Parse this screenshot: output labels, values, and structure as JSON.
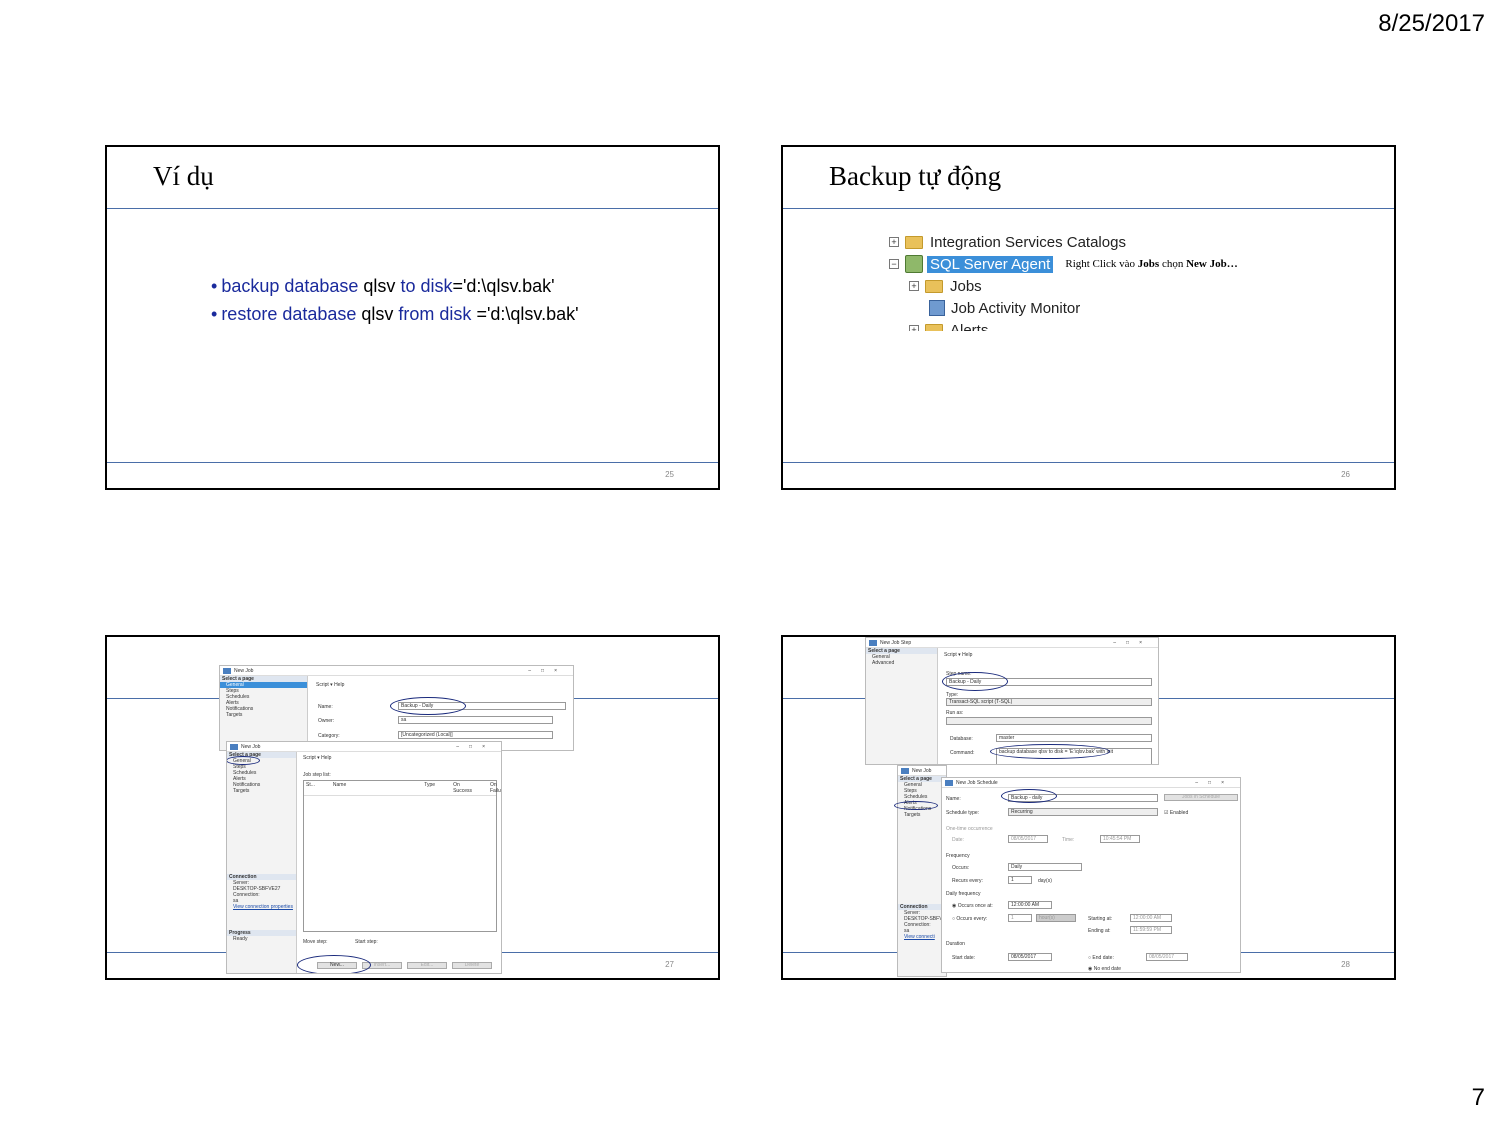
{
  "header": {
    "date": "8/25/2017"
  },
  "footer": {
    "page_number": "7"
  },
  "slides": [
    {
      "title": "Ví dụ",
      "number": "25",
      "lines": [
        {
          "bullet": "•",
          "kw1": "backup database",
          "t1": " qlsv ",
          "kw2": "to disk",
          "t2": "='d:\\qlsv.bak'"
        },
        {
          "bullet": "•",
          "kw1": "restore database",
          "t1": " qlsv ",
          "kw2": "from disk",
          "t2": " ='d:\\qlsv.bak'"
        }
      ]
    },
    {
      "title": "Backup tự động",
      "number": "26",
      "tree": {
        "integration": "Integration Services Catalogs",
        "agent": "SQL Server Agent",
        "note_pre": "Right Click vào ",
        "note_jobs": "Jobs",
        "note_mid": " chọn ",
        "note_newjob": "New Job…",
        "jobs": "Jobs",
        "monitor": "Job Activity Monitor",
        "alerts": "Alerts"
      }
    },
    {
      "number": "27",
      "win1": {
        "title": "New Job",
        "pages_header": "Select a page",
        "pages": [
          "General",
          "Steps",
          "Schedules",
          "Alerts",
          "Notifications",
          "Targets"
        ],
        "toolbar": "Script  ▾  Help",
        "name_label": "Name:",
        "name_value": "Backup - Daily",
        "owner_label": "Owner:",
        "owner_value": "sa",
        "category_label": "Category:",
        "category_value": "[Uncategorized (Local)]"
      },
      "win2": {
        "title": "New Job",
        "pages_header": "Select a page",
        "pages": [
          "General",
          "Steps",
          "Schedules",
          "Alerts",
          "Notifications",
          "Targets"
        ],
        "toolbar": "Script  ▾  Help",
        "list_label": "Job step list:",
        "columns": [
          "St...",
          "Name",
          "Type",
          "On Success",
          "On Failure"
        ],
        "connection_header": "Connection",
        "server_label": "Server:",
        "server_value": "DESKTOP-SBFVE27",
        "conn_label": "Connection:",
        "conn_value": "sa",
        "view_link": "View connection properties",
        "progress_header": "Progress",
        "progress_value": "Ready",
        "move_label": "Move step:",
        "start_label": "Start step:",
        "buttons": [
          "New...",
          "Insert...",
          "Edit...",
          "Delete"
        ]
      }
    },
    {
      "number": "28",
      "win3": {
        "title": "New Job Step",
        "pages_header": "Select a page",
        "pages": [
          "General",
          "Advanced"
        ],
        "toolbar": "Script  ▾  Help",
        "step_label": "Step name:",
        "step_value": "Backup - Daily",
        "type_label": "Type:",
        "type_value": "Transact-SQL script (T-SQL)",
        "runas_label": "Run as:",
        "db_label": "Database:",
        "db_value": "master",
        "cmd_label": "Command:",
        "cmd_value": "backup database qlsv to disk = 'E:\\qlsv.bak'  with init"
      },
      "win4": {
        "title": "New Job",
        "pages_header": "Select a page",
        "pages": [
          "General",
          "Steps",
          "Schedules",
          "Alerts",
          "Notifications",
          "Targets"
        ],
        "connection_header": "Connection",
        "server_label": "Server:",
        "server_value": "DESKTOP-SBFVE",
        "conn_label": "Connection:",
        "conn_value": "sa",
        "view_link": "View connecti"
      },
      "win5": {
        "title": "New Job Schedule",
        "name_label": "Name:",
        "name_value": "Backup - daily",
        "jobs_btn": "Jobs in Schedule",
        "type_label": "Schedule type:",
        "type_value": "Recurring",
        "enabled": "Enabled",
        "one_time": "One-time occurrence",
        "date_label": "Date:",
        "date_value": "08/05/2017",
        "time_label": "Time:",
        "time_value": "10:45:54 PM",
        "frequency": "Frequency",
        "occurs_label": "Occurs:",
        "occurs_value": "Daily",
        "recurs_label": "Recurs every:",
        "recurs_value": "1",
        "recurs_unit": "day(s)",
        "daily_freq": "Daily frequency",
        "once_label": "Occurs once at:",
        "once_value": "12:00:00 AM",
        "every_label": "Occurs every:",
        "every_value": "1",
        "every_unit": "hour(s)",
        "starting_label": "Starting at:",
        "starting_value": "12:00:00 AM",
        "ending_label": "Ending at:",
        "ending_value": "11:59:59 PM",
        "duration": "Duration",
        "start_label": "Start date:",
        "start_value": "08/05/2017",
        "end_label": "End date:",
        "end_value": "08/05/2017",
        "noend_label": "No end date"
      }
    }
  ]
}
